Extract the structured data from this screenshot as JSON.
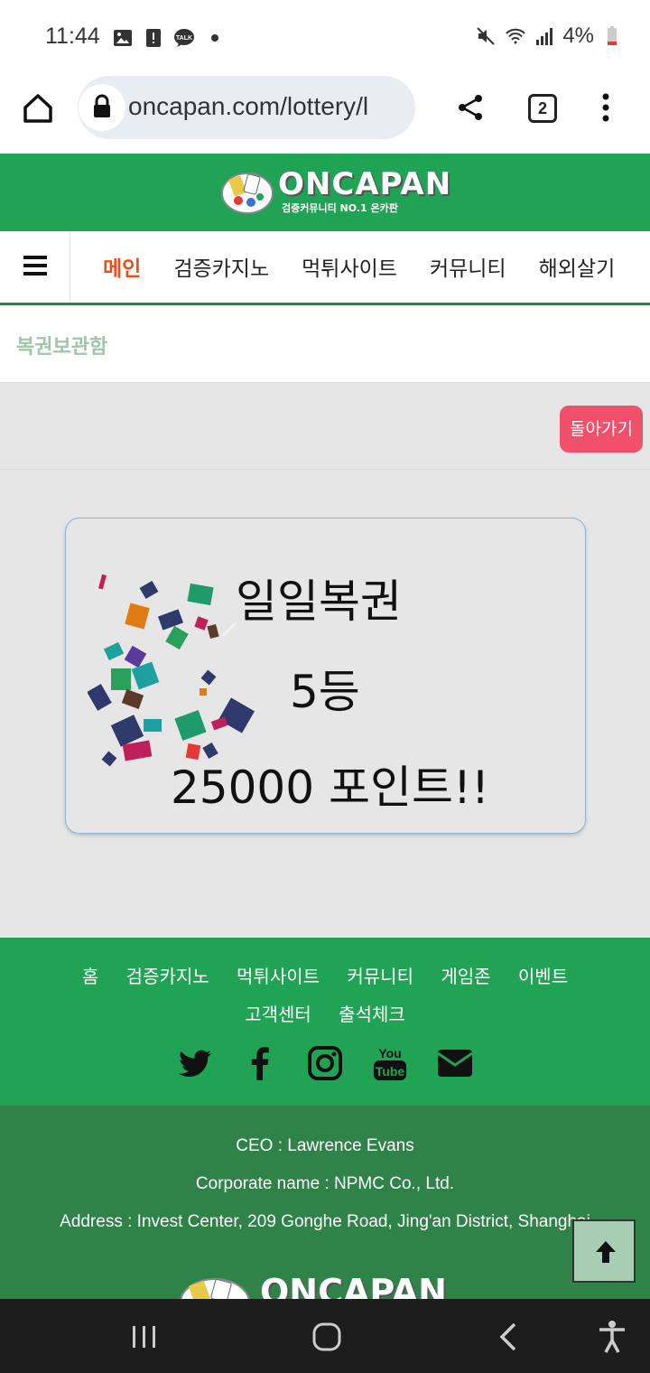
{
  "status_bar": {
    "time": "11:44",
    "battery_pct": "4%",
    "icons_left": [
      "gallery-icon",
      "alert-icon",
      "talk-icon",
      "dot-icon"
    ],
    "icons_right": [
      "mute-icon",
      "wifi-icon",
      "signal-icon",
      "battery-icon"
    ]
  },
  "browser": {
    "url": "oncapan.com/lottery/l",
    "tab_count": "2"
  },
  "site": {
    "logo_text": "ONCAPAN",
    "logo_sub": "검증커뮤니티 NO.1 온카판"
  },
  "nav": {
    "items": [
      {
        "label": "메인",
        "active": true
      },
      {
        "label": "검증카지노"
      },
      {
        "label": "먹튀사이트"
      },
      {
        "label": "커뮤니티"
      },
      {
        "label": "해외살기"
      }
    ]
  },
  "breadcrumb": "복권보관함",
  "back_button": "돌아가기",
  "ticket": {
    "title": "일일복권",
    "rank": "5등",
    "prize": "25000 포인트!!"
  },
  "footer": {
    "links_row1": [
      "홈",
      "검증카지노",
      "먹튀사이트",
      "커뮤니티",
      "게임존",
      "이벤트"
    ],
    "links_row2": [
      "고객센터",
      "출석체크"
    ],
    "social": [
      "twitter-icon",
      "facebook-icon",
      "instagram-icon",
      "youtube-icon",
      "email-icon"
    ],
    "ceo": "CEO : Lawrence Evans",
    "corporate": "Corporate name : NPMC Co., Ltd.",
    "address": "Address : Invest Center, 209 Gonghe Road, Jing'an District, Shanghai",
    "logo_text": "ONCAPAN"
  },
  "colors": {
    "brand_green": "#21a355",
    "footer_dark_green": "#2f8349",
    "active_nav": "#e8501e",
    "back_button": "#f0506a"
  }
}
